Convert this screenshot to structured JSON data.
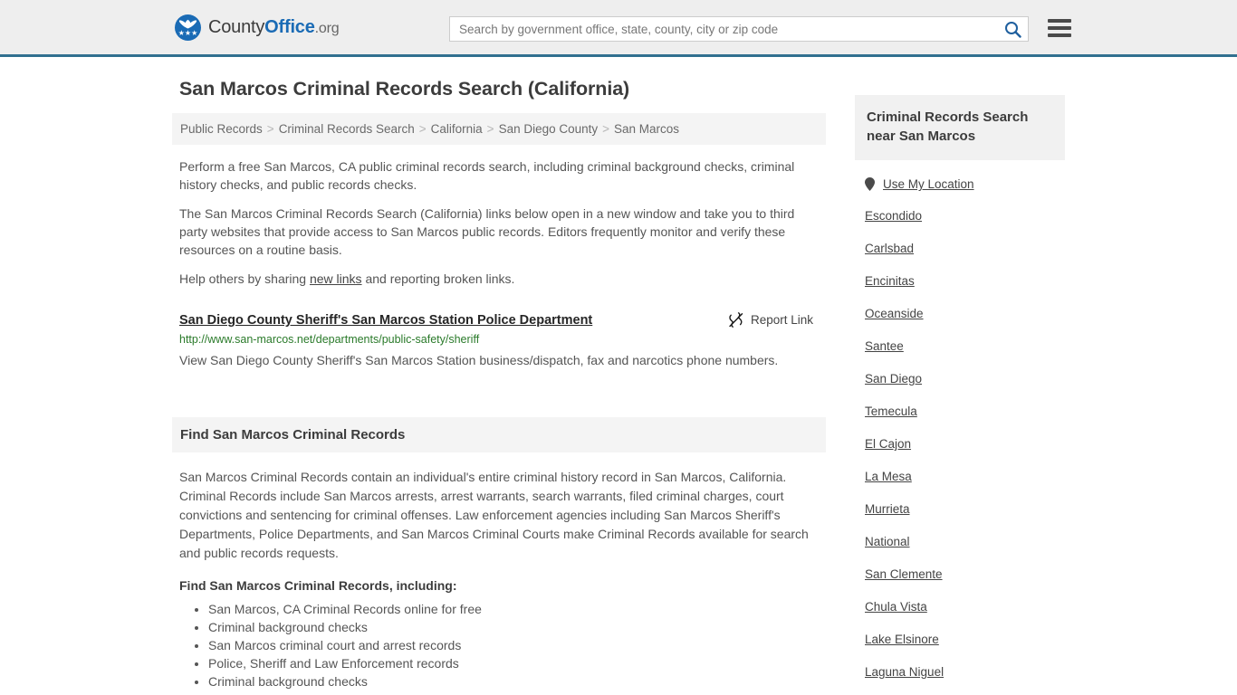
{
  "header": {
    "logo": {
      "name_part1": "County",
      "name_part2": "Office",
      "name_part3": ".org",
      "stars": "★★★"
    },
    "search": {
      "placeholder": "Search by government office, state, county, city or zip code",
      "value": ""
    },
    "search_icon": "search-icon",
    "menu_icon": "hamburger-menu-icon"
  },
  "page": {
    "title": "San Marcos Criminal Records Search (California)"
  },
  "breadcrumb": {
    "separator": ">",
    "items": [
      {
        "label": "Public Records"
      },
      {
        "label": "Criminal Records Search"
      },
      {
        "label": "California"
      },
      {
        "label": "San Diego County"
      },
      {
        "label": "San Marcos"
      }
    ]
  },
  "intro": {
    "p1": "Perform a free San Marcos, CA public criminal records search, including criminal background checks, criminal history checks, and public records checks.",
    "p2": "The San Marcos Criminal Records Search (California) links below open in a new window and take you to third party websites that provide access to San Marcos public records. Editors frequently monitor and verify these resources on a routine basis.",
    "p3_before": "Help others by sharing ",
    "p3_link": "new links",
    "p3_after": " and reporting broken links."
  },
  "link_entry": {
    "title": "San Diego County Sheriff's San Marcos Station Police Department",
    "url": "http://www.san-marcos.net/departments/public-safety/sheriff",
    "description": "View San Diego County Sheriff's San Marcos Station business/dispatch, fax and narcotics phone numbers.",
    "report_label": "Report Link",
    "report_icon": "broken-link-icon"
  },
  "section": {
    "heading": "Find San Marcos Criminal Records",
    "body": "San Marcos Criminal Records contain an individual's entire criminal history record in San Marcos, California. Criminal Records include San Marcos arrests, arrest warrants, search warrants, filed criminal charges, court convictions and sentencing for criminal offenses. Law enforcement agencies including San Marcos Sheriff's Departments, Police Departments, and San Marcos Criminal Courts make Criminal Records available for search and public records requests.",
    "sub_heading": "Find San Marcos Criminal Records, including:",
    "bullets": [
      "San Marcos, CA Criminal Records online for free",
      "Criminal background checks",
      "San Marcos criminal court and arrest records",
      "Police, Sheriff and Law Enforcement records",
      "Criminal background checks"
    ]
  },
  "sidebar": {
    "heading": "Criminal Records Search near San Marcos",
    "use_my_location": "Use My Location",
    "location_icon": "map-pin-icon",
    "cities": [
      {
        "label": "Escondido"
      },
      {
        "label": "Carlsbad"
      },
      {
        "label": "Encinitas"
      },
      {
        "label": "Oceanside"
      },
      {
        "label": "Santee"
      },
      {
        "label": "San Diego"
      },
      {
        "label": "Temecula"
      },
      {
        "label": "El Cajon"
      },
      {
        "label": "La Mesa"
      },
      {
        "label": "Murrieta"
      },
      {
        "label": "National"
      },
      {
        "label": "San Clemente"
      },
      {
        "label": "Chula Vista"
      },
      {
        "label": "Lake Elsinore"
      },
      {
        "label": "Laguna Niguel"
      }
    ]
  },
  "colors": {
    "brand_blue": "#1a6bb5",
    "header_rule": "#31708f",
    "url_green": "#2a7a2a",
    "panel_gray": "#f4f4f4",
    "header_bg": "#eeeeee"
  }
}
